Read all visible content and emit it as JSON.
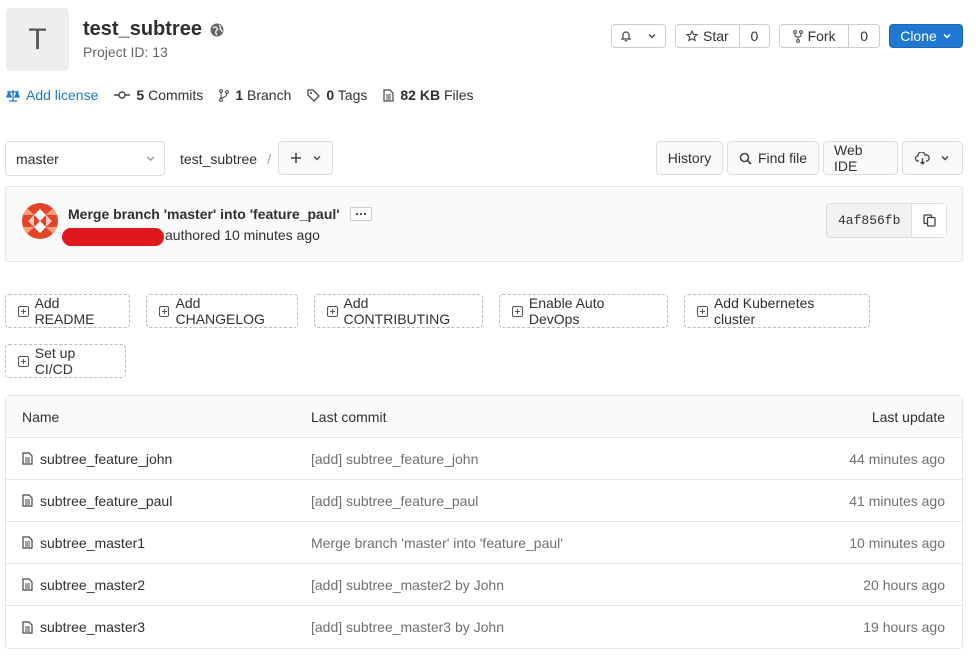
{
  "project": {
    "avatar_letter": "T",
    "name": "test_subtree",
    "id_label": "Project ID: 13"
  },
  "header_buttons": {
    "star_label": "Star",
    "star_count": "0",
    "fork_label": "Fork",
    "fork_count": "0",
    "clone_label": "Clone"
  },
  "stats": {
    "license": "Add license",
    "commits_count": "5",
    "commits_label": "Commits",
    "branch_count": "1",
    "branch_label": "Branch",
    "tags_count": "0",
    "tags_label": "Tags",
    "files_size": "82 KB",
    "files_label": "Files"
  },
  "repo_nav": {
    "branch": "master",
    "path_root": "test_subtree",
    "path_sep": "/",
    "history": "History",
    "find_file": "Find file",
    "web_ide": "Web IDE"
  },
  "last_commit": {
    "title": "Merge branch 'master' into 'feature_paul'",
    "authored": "authored 10 minutes ago",
    "sha": "4af856fb"
  },
  "suggestions": [
    "Add README",
    "Add CHANGELOG",
    "Add CONTRIBUTING",
    "Enable Auto DevOps",
    "Add Kubernetes cluster",
    "Set up CI/CD"
  ],
  "file_table": {
    "headers": {
      "name": "Name",
      "last_commit": "Last commit",
      "last_update": "Last update"
    },
    "rows": [
      {
        "name": "subtree_feature_john",
        "commit": "[add] subtree_feature_john",
        "updated": "44 minutes ago"
      },
      {
        "name": "subtree_feature_paul",
        "commit": "[add] subtree_feature_paul",
        "updated": "41 minutes ago"
      },
      {
        "name": "subtree_master1",
        "commit": "Merge branch 'master' into 'feature_paul'",
        "updated": "10 minutes ago"
      },
      {
        "name": "subtree_master2",
        "commit": "[add] subtree_master2 by John",
        "updated": "20 hours ago"
      },
      {
        "name": "subtree_master3",
        "commit": "[add] subtree_master3 by John",
        "updated": "19 hours ago"
      }
    ]
  },
  "colors": {
    "primary": "#1f78d1",
    "redaction": "#e0181e",
    "avatar": "#e24329"
  }
}
